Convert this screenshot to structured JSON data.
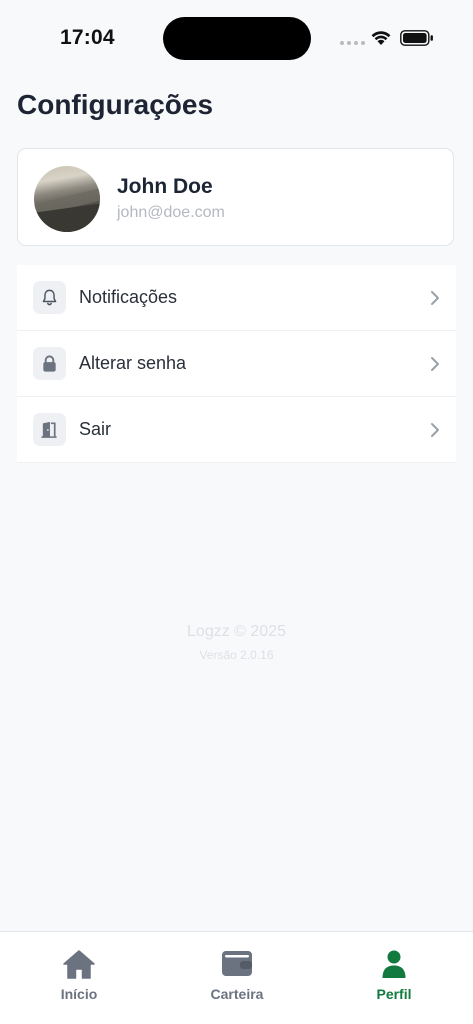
{
  "status_bar": {
    "time": "17:04"
  },
  "header": {
    "title": "Configurações"
  },
  "profile": {
    "name": "John Doe",
    "email": "john@doe.com"
  },
  "menu": {
    "items": [
      {
        "label": "Notificações",
        "icon": "bell-icon"
      },
      {
        "label": "Alterar senha",
        "icon": "lock-icon"
      },
      {
        "label": "Sair",
        "icon": "door-exit-icon"
      }
    ]
  },
  "footer": {
    "brand": "Logzz © 2025",
    "version": "Versão 2.0.16"
  },
  "tab_bar": {
    "tabs": [
      {
        "label": "Início",
        "icon": "home-icon",
        "active": false
      },
      {
        "label": "Carteira",
        "icon": "wallet-icon",
        "active": false
      },
      {
        "label": "Perfil",
        "icon": "user-icon",
        "active": true
      }
    ]
  },
  "colors": {
    "accent": "#127a3f",
    "icon_gray": "#6b7280",
    "background": "#f8f9fb"
  }
}
